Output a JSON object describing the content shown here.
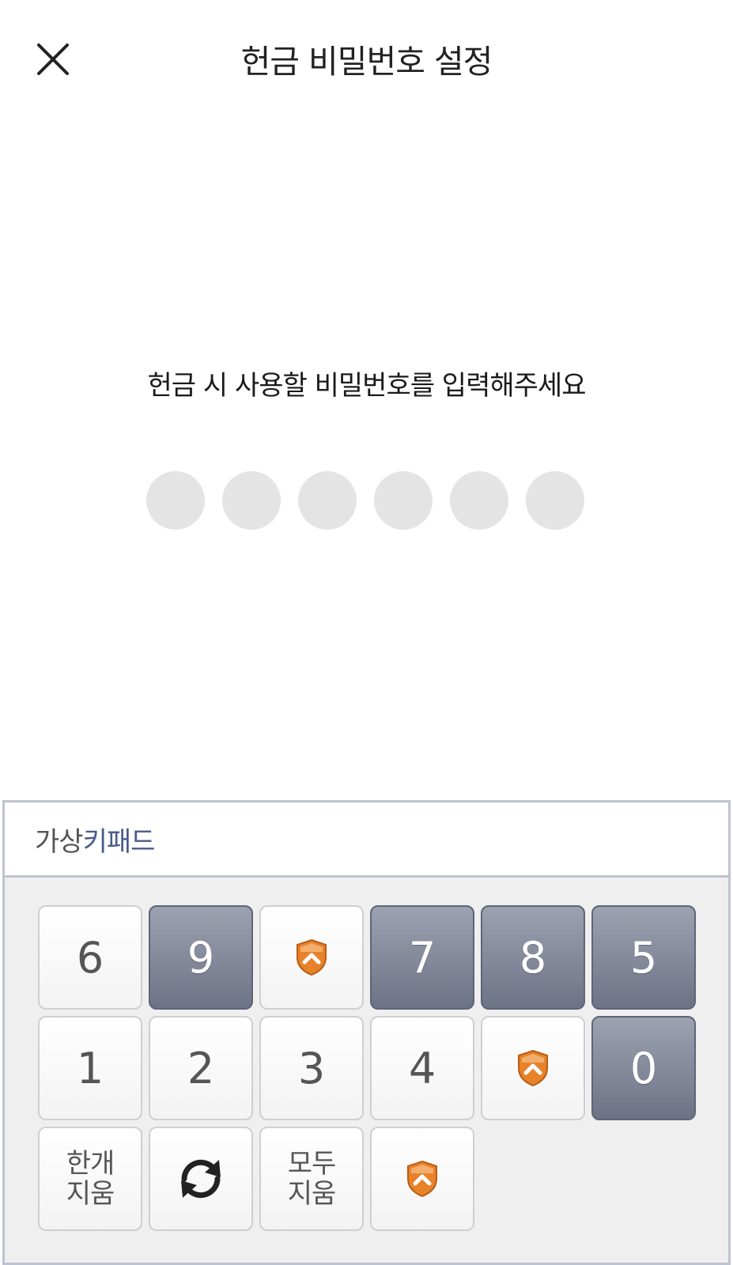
{
  "header": {
    "title": "헌금 비밀번호 설정",
    "close_icon": "close-icon"
  },
  "prompt": {
    "text": "헌금 시 사용할 비밀번호를 입력해주세요"
  },
  "pin": {
    "length": 6,
    "filled": 0,
    "dot_color": "#e4e4e4"
  },
  "keypad": {
    "title_part1": "가상",
    "title_part2": "키패드",
    "rows": [
      [
        {
          "label": "6",
          "style": "light"
        },
        {
          "label": "9",
          "style": "dark"
        },
        {
          "icon": "shield-logo-icon",
          "style": "light"
        },
        {
          "label": "7",
          "style": "dark"
        },
        {
          "label": "8",
          "style": "dark"
        },
        {
          "label": "5",
          "style": "dark"
        }
      ],
      [
        {
          "label": "1",
          "style": "light"
        },
        {
          "label": "2",
          "style": "light"
        },
        {
          "label": "3",
          "style": "light"
        },
        {
          "label": "4",
          "style": "light"
        },
        {
          "icon": "shield-logo-icon",
          "style": "light"
        },
        {
          "label": "0",
          "style": "dark"
        }
      ],
      [
        {
          "label_line1": "한개",
          "label_line2": "지움",
          "style": "light"
        },
        {
          "icon": "refresh-icon",
          "style": "light"
        },
        {
          "label_line1": "모두",
          "label_line2": "지움",
          "style": "light"
        },
        {
          "icon": "shield-logo-icon",
          "style": "light"
        }
      ]
    ],
    "colors": {
      "border": "#bec3d3",
      "dark_key": "#7a8092",
      "accent_text": "#4a5a8c",
      "shield_orange": "#e8822a"
    }
  }
}
